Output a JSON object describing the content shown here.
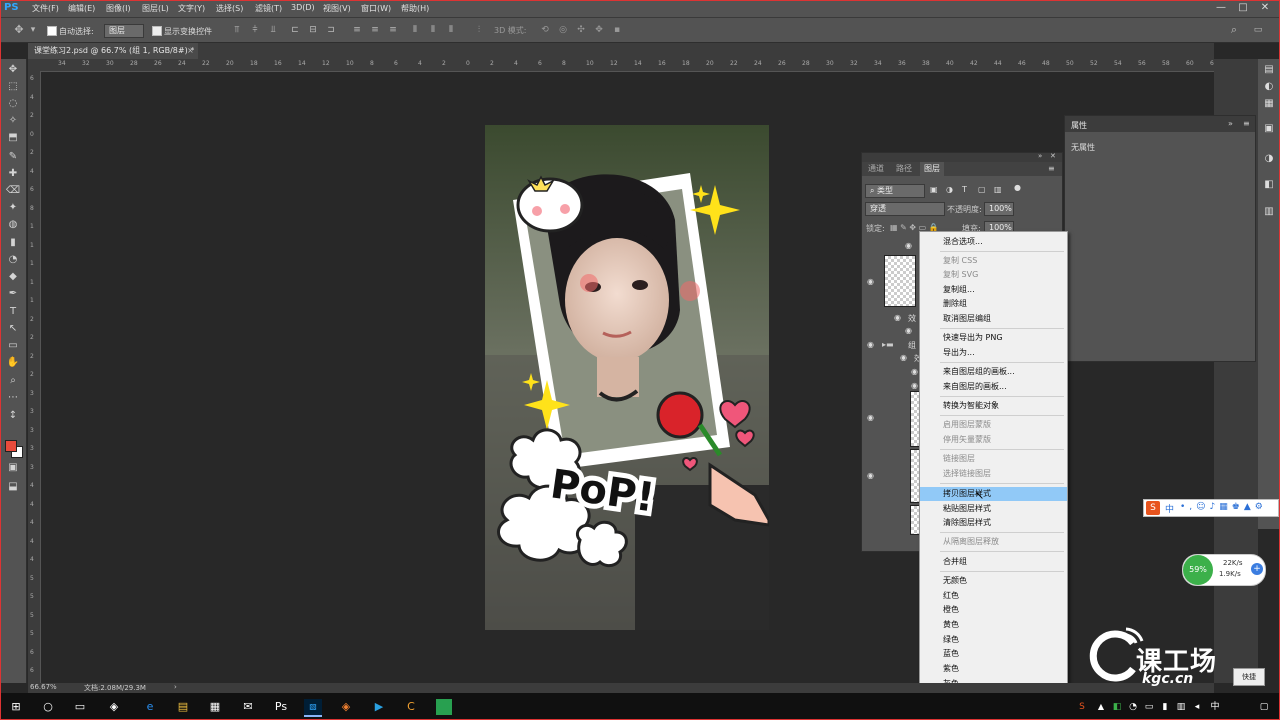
{
  "app": {
    "logo": "PS"
  },
  "menubar": {
    "items": [
      "文件(F)",
      "编辑(E)",
      "图像(I)",
      "图层(L)",
      "文字(Y)",
      "选择(S)",
      "滤镜(T)",
      "3D(D)",
      "视图(V)",
      "窗口(W)",
      "帮助(H)"
    ],
    "window_controls": [
      "—",
      "□",
      "✕"
    ]
  },
  "options": {
    "auto_select_label": "自动选择:",
    "auto_select_value": "图层",
    "show_transform_label": "显示变换控件"
  },
  "document": {
    "tab_title": "课堂练习2.psd @ 66.7% (组 1, RGB/8#) *",
    "zoom": "66.67%",
    "doc_size": "文档:2.08M/29.3M"
  },
  "rulers": {
    "h": [
      "34",
      "32",
      "30",
      "28",
      "26",
      "24",
      "22",
      "20",
      "18",
      "16",
      "14",
      "12",
      "10",
      "8",
      "6",
      "4",
      "2",
      "0",
      "2",
      "4",
      "6",
      "8",
      "10",
      "12",
      "14",
      "16",
      "18",
      "20",
      "22",
      "24",
      "26",
      "28",
      "30",
      "32",
      "34",
      "36",
      "38",
      "40",
      "42",
      "44",
      "46",
      "48",
      "50",
      "52",
      "54",
      "56",
      "58",
      "60",
      "62"
    ],
    "v": [
      "6",
      "4",
      "2",
      "0",
      "2",
      "4",
      "6",
      "8",
      "1",
      "1",
      "1",
      "1",
      "1",
      "2",
      "2",
      "2",
      "2",
      "3",
      "3",
      "3",
      "3",
      "3",
      "4",
      "4",
      "4",
      "4",
      "4",
      "5",
      "5",
      "5",
      "5",
      "6",
      "6"
    ]
  },
  "tools": [
    "✥",
    "⬚",
    "◌",
    "✧",
    "⬒",
    "✎",
    "✚",
    "⌫",
    "✦",
    "◍",
    "▮",
    "◔",
    "◆",
    "✒",
    "T",
    "↖",
    "▭",
    "✋",
    "⌕",
    "⋯",
    "↕",
    "▣",
    "⬓",
    "▢"
  ],
  "colors": {
    "foreground": "#e94b3c",
    "background": "#ffffff",
    "highlight": "#91c9f7"
  },
  "properties_panel": {
    "title": "属性",
    "body": "无属性"
  },
  "layers_panel": {
    "tabs": [
      "通道",
      "路径",
      "图层"
    ],
    "filter_label": "类型",
    "blend_mode": "穿透",
    "opacity_label": "不透明度:",
    "opacity_value": "100%",
    "lock_label": "锁定:",
    "fill_label": "填充:",
    "fill_value": "100%",
    "layer_fragments": [
      "效",
      "组",
      "效"
    ]
  },
  "context_menu": {
    "items": [
      {
        "label": "混合选项...",
        "disabled": false
      },
      {
        "label": "复制 CSS",
        "disabled": true
      },
      {
        "label": "复制 SVG",
        "disabled": true
      },
      {
        "label": "复制组...",
        "disabled": false
      },
      {
        "label": "删除组",
        "disabled": false
      },
      {
        "label": "取消图层编组",
        "disabled": false
      },
      {
        "label": "快速导出为 PNG",
        "disabled": false
      },
      {
        "label": "导出为...",
        "disabled": false
      },
      {
        "label": "来自图层组的画板...",
        "disabled": false
      },
      {
        "label": "来自图层的画板...",
        "disabled": false
      },
      {
        "label": "转换为智能对象",
        "disabled": false
      },
      {
        "label": "启用图层蒙版",
        "disabled": true
      },
      {
        "label": "停用矢量蒙版",
        "disabled": true
      },
      {
        "label": "链接图层",
        "disabled": true
      },
      {
        "label": "选择链接图层",
        "disabled": true
      },
      {
        "label": "拷贝图层样式",
        "disabled": false,
        "highlighted": true
      },
      {
        "label": "粘贴图层样式",
        "disabled": false
      },
      {
        "label": "清除图层样式",
        "disabled": false
      },
      {
        "label": "从隔离图层释放",
        "disabled": true
      },
      {
        "label": "合并组",
        "disabled": false
      },
      {
        "label": "无颜色",
        "disabled": false
      },
      {
        "label": "红色",
        "disabled": false
      },
      {
        "label": "橙色",
        "disabled": false
      },
      {
        "label": "黄色",
        "disabled": false
      },
      {
        "label": "绿色",
        "disabled": false
      },
      {
        "label": "蓝色",
        "disabled": false
      },
      {
        "label": "紫色",
        "disabled": false
      },
      {
        "label": "灰色",
        "disabled": false
      }
    ]
  },
  "photo_stickers": {
    "pop_text": "PoP!"
  },
  "net_widget": {
    "percent": "59%",
    "up": "22K/s",
    "down": "1.9K/s"
  },
  "ime_bar": {
    "lang": "中"
  },
  "watermark": {
    "brand": "课工场",
    "domain": "kgc.cn"
  },
  "taskbar": {
    "icons": [
      "⊞",
      "○",
      "▭",
      "◈",
      "e",
      "▤",
      "▦",
      "✉",
      "Ps",
      "▧",
      "◈",
      "▶",
      "C"
    ],
    "tray_icons": [
      "S",
      "▲",
      "◧",
      "◔",
      "▭",
      "▮",
      "▥",
      "◂",
      "中",
      "▢"
    ],
    "tray_popup": "快捷"
  }
}
